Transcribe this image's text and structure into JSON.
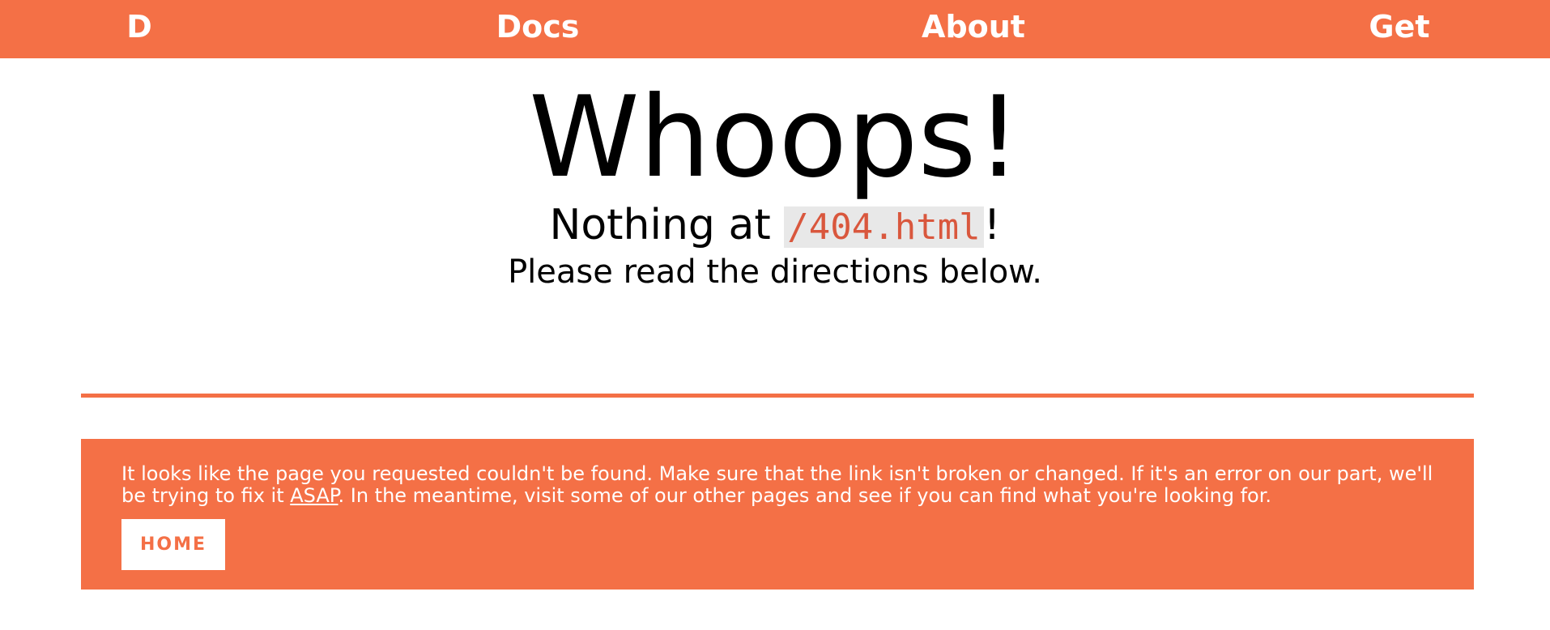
{
  "nav": {
    "items": [
      {
        "label": "D"
      },
      {
        "label": "Docs"
      },
      {
        "label": "About"
      },
      {
        "label": "Get"
      }
    ]
  },
  "hero": {
    "title": "Whoops!",
    "subtitle_prefix": "Nothing at ",
    "path": "/404.html",
    "subtitle_suffix": "!",
    "note": "Please read the directions below."
  },
  "notice": {
    "text_part1": "It looks like the page you requested couldn't be found. Make sure that the link isn't broken or changed. If it's an error on our part, we'll be trying to fix it ",
    "link_label": "ASAP",
    "text_part2": ". In the meantime, visit some of our other pages and see if you can find what you're looking for.",
    "home_button_label": "HOME"
  },
  "colors": {
    "accent": "#f47046",
    "code_text": "#d9573d",
    "code_background": "#e8e8e8"
  }
}
